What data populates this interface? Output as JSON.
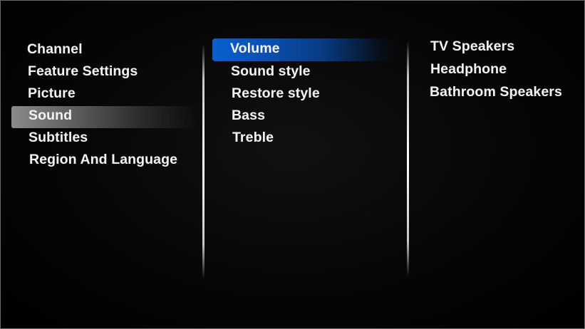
{
  "menu": {
    "level1": {
      "items": [
        {
          "label": "Channel"
        },
        {
          "label": "Feature Settings"
        },
        {
          "label": "Picture"
        },
        {
          "label": "Sound"
        },
        {
          "label": "Subtitles"
        },
        {
          "label": "Region And Language"
        }
      ],
      "selected": "Sound"
    },
    "level2": {
      "items": [
        {
          "label": "Volume"
        },
        {
          "label": "Sound style"
        },
        {
          "label": "Restore style"
        },
        {
          "label": "Bass"
        },
        {
          "label": "Treble"
        }
      ],
      "focused": "Volume"
    },
    "level3": {
      "items": [
        {
          "label": "TV Speakers"
        },
        {
          "label": "Headphone"
        },
        {
          "label": "Bathroom Speakers"
        }
      ]
    }
  },
  "colors": {
    "background": "#000000",
    "text": "#f2f2f2",
    "focus_highlight": "#0a5fd0",
    "selected_highlight": "#8a8a8a"
  }
}
